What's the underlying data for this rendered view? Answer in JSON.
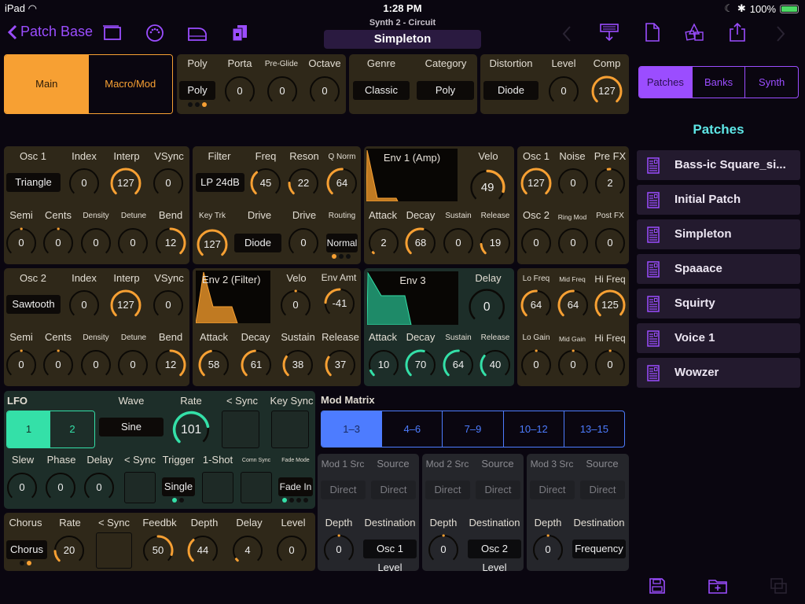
{
  "status_bar": {
    "device": "iPad",
    "time": "1:28 PM",
    "battery": "100%"
  },
  "nav": {
    "back_label": "Patch Base",
    "subtitle": "Synth 2 - Circuit",
    "title": "Simpleton",
    "left_icons": [
      "windows-icon",
      "midi-port-icon",
      "keyboard-icon",
      "copy-doc-icon"
    ],
    "right_icons": [
      "chevron-left-icon",
      "download-to-synth-icon",
      "new-document-icon",
      "random-dice-icon",
      "share-icon",
      "chevron-right-icon"
    ]
  },
  "mode_tabs": {
    "items": [
      "Main",
      "Macro/Mod"
    ],
    "selected": 0
  },
  "voice": {
    "poly_label": "Poly",
    "poly_value": "Poly",
    "poly_dots": 3,
    "poly_dot_active": 2,
    "knobs": [
      {
        "label": "Porta",
        "value": 0
      },
      {
        "label": "Pre-Glide",
        "value": 0
      },
      {
        "label": "Octave",
        "value": 0
      }
    ]
  },
  "genre": {
    "genre_label": "Genre",
    "genre_value": "Classic",
    "category_label": "Category",
    "category_value": "Poly"
  },
  "dist": {
    "dist_label": "Distortion",
    "dist_value": "Diode",
    "level_label": "Level",
    "level_value": 0,
    "comp_label": "Comp",
    "comp_value": 127
  },
  "osc1": {
    "title": "Osc 1",
    "wave": "Triangle",
    "top": [
      {
        "label": "Index",
        "value": 0
      },
      {
        "label": "Interp",
        "value": 127
      },
      {
        "label": "VSync",
        "value": 0
      }
    ],
    "bottom": [
      {
        "label": "Semi",
        "value": 0
      },
      {
        "label": "Cents",
        "value": 0
      },
      {
        "label": "Density",
        "value": 0
      },
      {
        "label": "Detune",
        "value": 0
      },
      {
        "label": "Bend",
        "value": 12
      }
    ]
  },
  "osc2": {
    "title": "Osc 2",
    "wave": "Sawtooth",
    "top": [
      {
        "label": "Index",
        "value": 0
      },
      {
        "label": "Interp",
        "value": 127
      },
      {
        "label": "VSync",
        "value": 0
      }
    ],
    "bottom": [
      {
        "label": "Semi",
        "value": 0
      },
      {
        "label": "Cents",
        "value": 0
      },
      {
        "label": "Density",
        "value": 0
      },
      {
        "label": "Detune",
        "value": 0
      },
      {
        "label": "Bend",
        "value": 12
      }
    ]
  },
  "filter": {
    "title": "Filter",
    "type": "LP 24dB",
    "freq": {
      "label": "Freq",
      "value": 45
    },
    "reson": {
      "label": "Reson",
      "value": 22
    },
    "qnorm": {
      "label": "Q Norm",
      "value": 64
    },
    "keytrk": {
      "label": "Key Trk",
      "value": 127
    },
    "drive_type_label": "Drive",
    "drive_type": "Diode",
    "drive": {
      "label": "Drive",
      "value": 0
    },
    "routing_label": "Routing",
    "routing": "Normal",
    "routing_dots": 3,
    "routing_dot_active": 0
  },
  "env1": {
    "title": "Env 1 (Amp)",
    "velo": {
      "label": "Velo",
      "value": 49
    },
    "adsr": [
      {
        "label": "Attack",
        "value": 2
      },
      {
        "label": "Decay",
        "value": 68
      },
      {
        "label": "Sustain",
        "value": 0
      },
      {
        "label": "Release",
        "value": 19
      }
    ]
  },
  "env2": {
    "title": "Env 2 (Filter)",
    "velo": {
      "label": "Velo",
      "value": 0
    },
    "amt": {
      "label": "Env Amt",
      "value": -41
    },
    "adsr": [
      {
        "label": "Attack",
        "value": 58
      },
      {
        "label": "Decay",
        "value": 61
      },
      {
        "label": "Sustain",
        "value": 38
      },
      {
        "label": "Release",
        "value": 37
      }
    ]
  },
  "env3": {
    "title": "Env 3",
    "delay": {
      "label": "Delay",
      "value": 0
    },
    "adsr": [
      {
        "label": "Attack",
        "value": 10
      },
      {
        "label": "Decay",
        "value": 70
      },
      {
        "label": "Sustain",
        "value": 64
      },
      {
        "label": "Release",
        "value": 40
      }
    ]
  },
  "mixer": {
    "top": [
      {
        "label": "Osc 1",
        "value": 127
      },
      {
        "label": "Noise",
        "value": 0
      },
      {
        "label": "Pre FX",
        "value": 2
      }
    ],
    "bottom": [
      {
        "label": "Osc 2",
        "value": 0
      },
      {
        "label": "Ring Mod",
        "value": 0
      },
      {
        "label": "Post FX",
        "value": 0
      }
    ]
  },
  "eq": {
    "top": [
      {
        "label": "Lo Freq",
        "value": 64
      },
      {
        "label": "Mid Freq",
        "value": 64
      },
      {
        "label": "Hi Freq",
        "value": 125
      }
    ],
    "bottom": [
      {
        "label": "Lo Gain",
        "value": 0
      },
      {
        "label": "Mid Gain",
        "value": 0
      },
      {
        "label": "Hi Freq",
        "value": 0
      }
    ]
  },
  "lfo": {
    "title": "LFO",
    "tabs": [
      "1",
      "2"
    ],
    "selected": 0,
    "wave_label": "Wave",
    "wave": "Sine",
    "rate": {
      "label": "Rate",
      "value": 101
    },
    "sync_label": "< Sync",
    "keysync_label": "Key Sync",
    "knobs": [
      {
        "label": "Slew",
        "value": 0
      },
      {
        "label": "Phase",
        "value": 0
      },
      {
        "label": "Delay",
        "value": 0
      }
    ],
    "sync2_label": "< Sync",
    "trigger_label": "Trigger",
    "trigger": "Single",
    "trigger_dots": 2,
    "trigger_dot_active": 0,
    "oneshot_label": "1-Shot",
    "comn_sync_label": "Comn Sync",
    "fade_mode_label": "Fade Mode",
    "fade_mode": "Fade In",
    "fade_dots": 4,
    "fade_dot_active": 0
  },
  "chorus": {
    "title": "Chorus",
    "type": "Chorus",
    "type_dots": 2,
    "type_dot_active": 1,
    "rate": {
      "label": "Rate",
      "value": 20
    },
    "sync_label": "< Sync",
    "knobs": [
      {
        "label": "Feedbk",
        "value": 50
      },
      {
        "label": "Depth",
        "value": 44
      },
      {
        "label": "Delay",
        "value": 4
      },
      {
        "label": "Level",
        "value": 0
      }
    ]
  },
  "modmatrix": {
    "title": "Mod Matrix",
    "tabs": [
      "1–3",
      "4–6",
      "7–9",
      "10–12",
      "13–15"
    ],
    "selected": 0,
    "slots": [
      {
        "src_label": "Mod 1 Src",
        "src": "Direct",
        "source_label": "Source",
        "source": "Direct",
        "depth_label": "Depth",
        "depth": 0,
        "dest_label": "Destination",
        "dest": "Osc 1 Level"
      },
      {
        "src_label": "Mod 2 Src",
        "src": "Direct",
        "source_label": "Source",
        "source": "Direct",
        "depth_label": "Depth",
        "depth": 0,
        "dest_label": "Destination",
        "dest": "Osc 2 Level"
      },
      {
        "src_label": "Mod 3 Src",
        "src": "Direct",
        "source_label": "Source",
        "source": "Direct",
        "depth_label": "Depth",
        "depth": 0,
        "dest_label": "Destination",
        "dest": "Frequency"
      }
    ]
  },
  "sidebar": {
    "tabs": [
      "Patches",
      "Banks",
      "Synth"
    ],
    "selected": 0,
    "heading": "Patches",
    "patches": [
      "Bass-ic Square_si...",
      "Initial Patch",
      "Simpleton",
      "Spaaace",
      "Squirty",
      "Voice 1",
      "Wowzer"
    ],
    "bottom_icons": [
      "save-icon",
      "new-folder-icon",
      "copy-icon"
    ]
  },
  "colors": {
    "accent_purple": "#9b4dff",
    "orange": "#f7a033",
    "green": "#34e0a8",
    "blue": "#4d7cff",
    "cyan_heading": "#5ee6e6",
    "panel_brown": "#2f2819",
    "panel_green": "#1d2e29"
  }
}
